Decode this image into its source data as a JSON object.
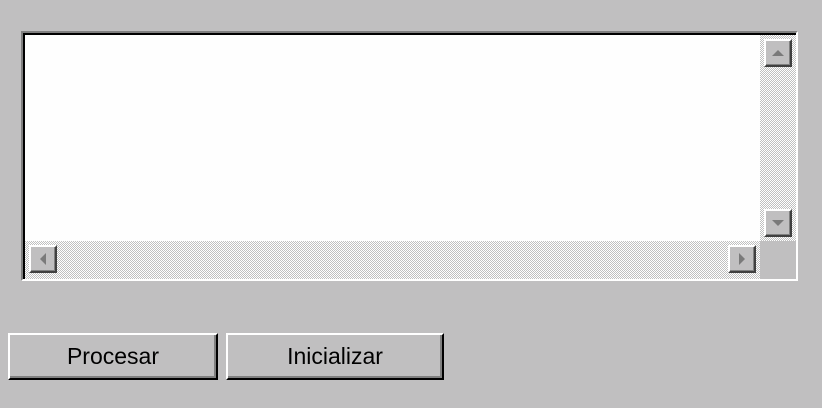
{
  "text_area": {
    "value": ""
  },
  "scrollbars": {
    "vertical": {
      "up_icon": "arrow-up-icon",
      "down_icon": "arrow-down-icon"
    },
    "horizontal": {
      "left_icon": "arrow-left-icon",
      "right_icon": "arrow-right-icon"
    }
  },
  "buttons": {
    "procesar": "Procesar",
    "inicializar": "Inicializar"
  },
  "colors": {
    "window_background": "#c0bfc0",
    "text_area_background": "#fefefe"
  }
}
